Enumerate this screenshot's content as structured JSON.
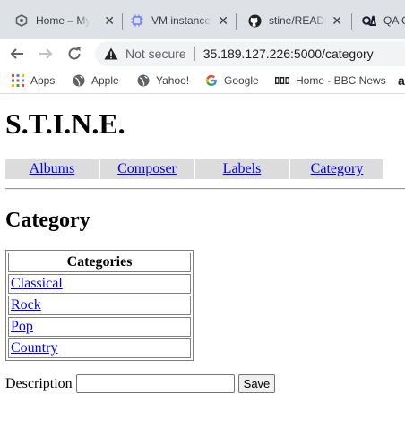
{
  "browser": {
    "tabs": [
      {
        "title": "Home – My",
        "icon": "google-cloud-icon"
      },
      {
        "title": "VM instance",
        "icon": "compute-engine-icon"
      },
      {
        "title": "stine/READM",
        "icon": "github-icon"
      },
      {
        "title": "QA C",
        "icon": "qa-icon"
      }
    ],
    "security_label": "Not secure",
    "url": "35.189.127.226:5000/category",
    "bookmarks": [
      {
        "label": "Apps",
        "icon": "apps-grid-icon"
      },
      {
        "label": "Apple",
        "icon": "globe-icon"
      },
      {
        "label": "Yahoo!",
        "icon": "globe-icon"
      },
      {
        "label": "Google",
        "icon": "google-icon"
      },
      {
        "label": "Home - BBC News",
        "icon": "bbc-icon"
      }
    ]
  },
  "page": {
    "site_title": "S.T.I.N.E.",
    "nav": [
      "Albums",
      "Composer",
      "Labels",
      "Category"
    ],
    "heading": "Category",
    "table": {
      "header": "Categories",
      "rows": [
        "Classical",
        "Rock",
        "Pop",
        "Country"
      ]
    },
    "form": {
      "description_label": "Description",
      "description_value": "",
      "save_label": "Save"
    }
  },
  "colors": {
    "tabstrip": "#dee1e6",
    "nav_bg": "#dcdcdc",
    "link": "#0000ee"
  }
}
